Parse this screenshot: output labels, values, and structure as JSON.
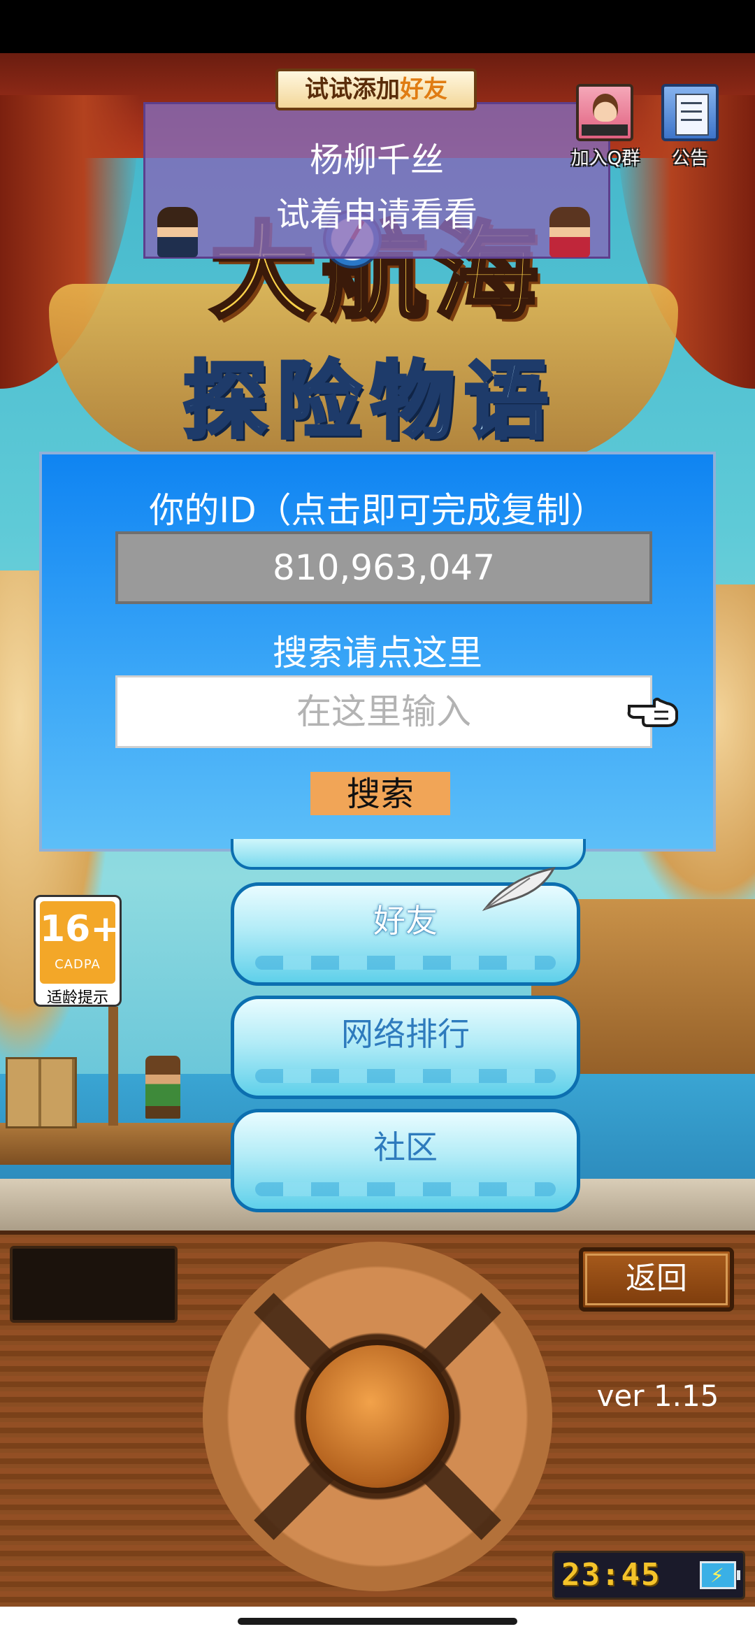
{
  "tip": {
    "title_prefix": "试试添加",
    "title_highlight": "好友",
    "friend_name": "杨柳千丝",
    "message": "试着申请看看"
  },
  "topbar": {
    "qq_group_label": "加入Q群",
    "notice_label": "公告"
  },
  "logo": {
    "title": "大航海",
    "subtitle": "探险物语"
  },
  "id_dialog": {
    "heading": "你的ID（点击即可完成复制）",
    "id_value": "810,963,047",
    "search_heading": "搜索请点这里",
    "search_placeholder": "在这里输入",
    "search_value": "",
    "search_button": "搜索"
  },
  "menu": {
    "friends": "好友",
    "ranking": "网络排行",
    "community": "社区"
  },
  "age_rating": {
    "age": "16+",
    "org": "CADPA",
    "note": "适龄提示"
  },
  "console": {
    "back_label": "返回",
    "version": "ver 1.15",
    "clock": "23:45",
    "battery": "charging"
  },
  "colors": {
    "dialog_top": "#0f84f2",
    "dialog_bottom": "#5dbff8",
    "search_button": "#f1a557",
    "tip_box": "#846ab8",
    "clock_text": "#f4c32a"
  }
}
